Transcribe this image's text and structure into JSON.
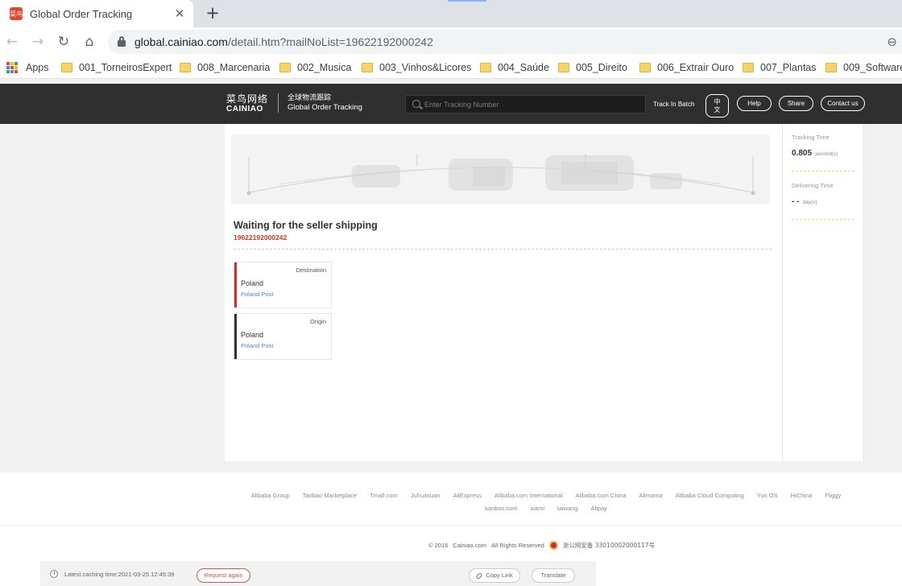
{
  "browser": {
    "tab_title": "Global Order Tracking",
    "favicon_text": "菜鸟",
    "url_host": "global.cainiao.com",
    "url_path": "/detail.htm?mailNoList=19622192000242",
    "bookmarks": [
      {
        "label": "Apps",
        "icon": "apps-grid-icon"
      },
      {
        "label": "001_TorneirosExpert",
        "icon": "folder-icon"
      },
      {
        "label": "008_Marcenaria",
        "icon": "folder-icon"
      },
      {
        "label": "002_Musica",
        "icon": "folder-icon"
      },
      {
        "label": "003_Vinhos&Licores",
        "icon": "folder-icon"
      },
      {
        "label": "004_Saúde",
        "icon": "folder-icon"
      },
      {
        "label": "005_Direito",
        "icon": "folder-icon"
      },
      {
        "label": "006_Extrair Ouro",
        "icon": "folder-icon"
      },
      {
        "label": "007_Plantas",
        "icon": "folder-icon"
      },
      {
        "label": "009_Software",
        "icon": "folder-icon"
      }
    ]
  },
  "header": {
    "logo_cn": "菜鸟网络",
    "logo_en": "CAINIAO",
    "subtitle_cn": "全球物流跟踪",
    "subtitle_en": "Global Order Tracking",
    "search_placeholder": "Enter Tracking Number",
    "track_batch": "Track In Batch",
    "lang_line1": "中",
    "lang_line2": "文",
    "help": "Help",
    "share": "Share",
    "contact": "Contact us"
  },
  "detail": {
    "status_title": "Waiting for the seller shipping",
    "tracking_number": "19622192000242",
    "destination": {
      "label": "Destination",
      "country": "Poland",
      "carrier": "Poland Post"
    },
    "origin": {
      "label": "Origin",
      "country": "Poland",
      "carrier": "Poland Post"
    }
  },
  "side": {
    "tracking_time_label": "Tracking Time",
    "tracking_time_value": "0.805",
    "tracking_time_unit": "second(s)",
    "delivering_time_label": "Delivering Time",
    "delivering_time_value": "- -",
    "delivering_time_unit": "day(s)"
  },
  "footer": {
    "links": [
      "Alibaba Group",
      "Taobao Marketplace",
      "Tmall.com",
      "Juhuasuan",
      "AliExpress",
      "Alibaba.com International",
      "Alibaba.com China",
      "Alimama",
      "Alibaba Cloud Computing",
      "Yun OS",
      "HiChina",
      "Fliggy",
      "kanbox.com",
      "xiami",
      "laiwang",
      "Alipay"
    ],
    "copyright_year": "© 2016",
    "copyright_site": "Cainiao.com",
    "rights": "All Rights Reserved",
    "icp": "浙公网安备 33010002000117号"
  },
  "cache_bar": {
    "caching_time": "Latest caching time:2021-03-25 12:45:39",
    "request_again": "Request again",
    "copy_link": "Copy Link",
    "translate": "Translate"
  },
  "colors": {
    "header_bg": "#2f2f2f",
    "destination_bar": "#c9302c",
    "origin_bar": "#333333",
    "tracking_number": "#c33a2d",
    "carrier_link": "#4a8ad1"
  }
}
